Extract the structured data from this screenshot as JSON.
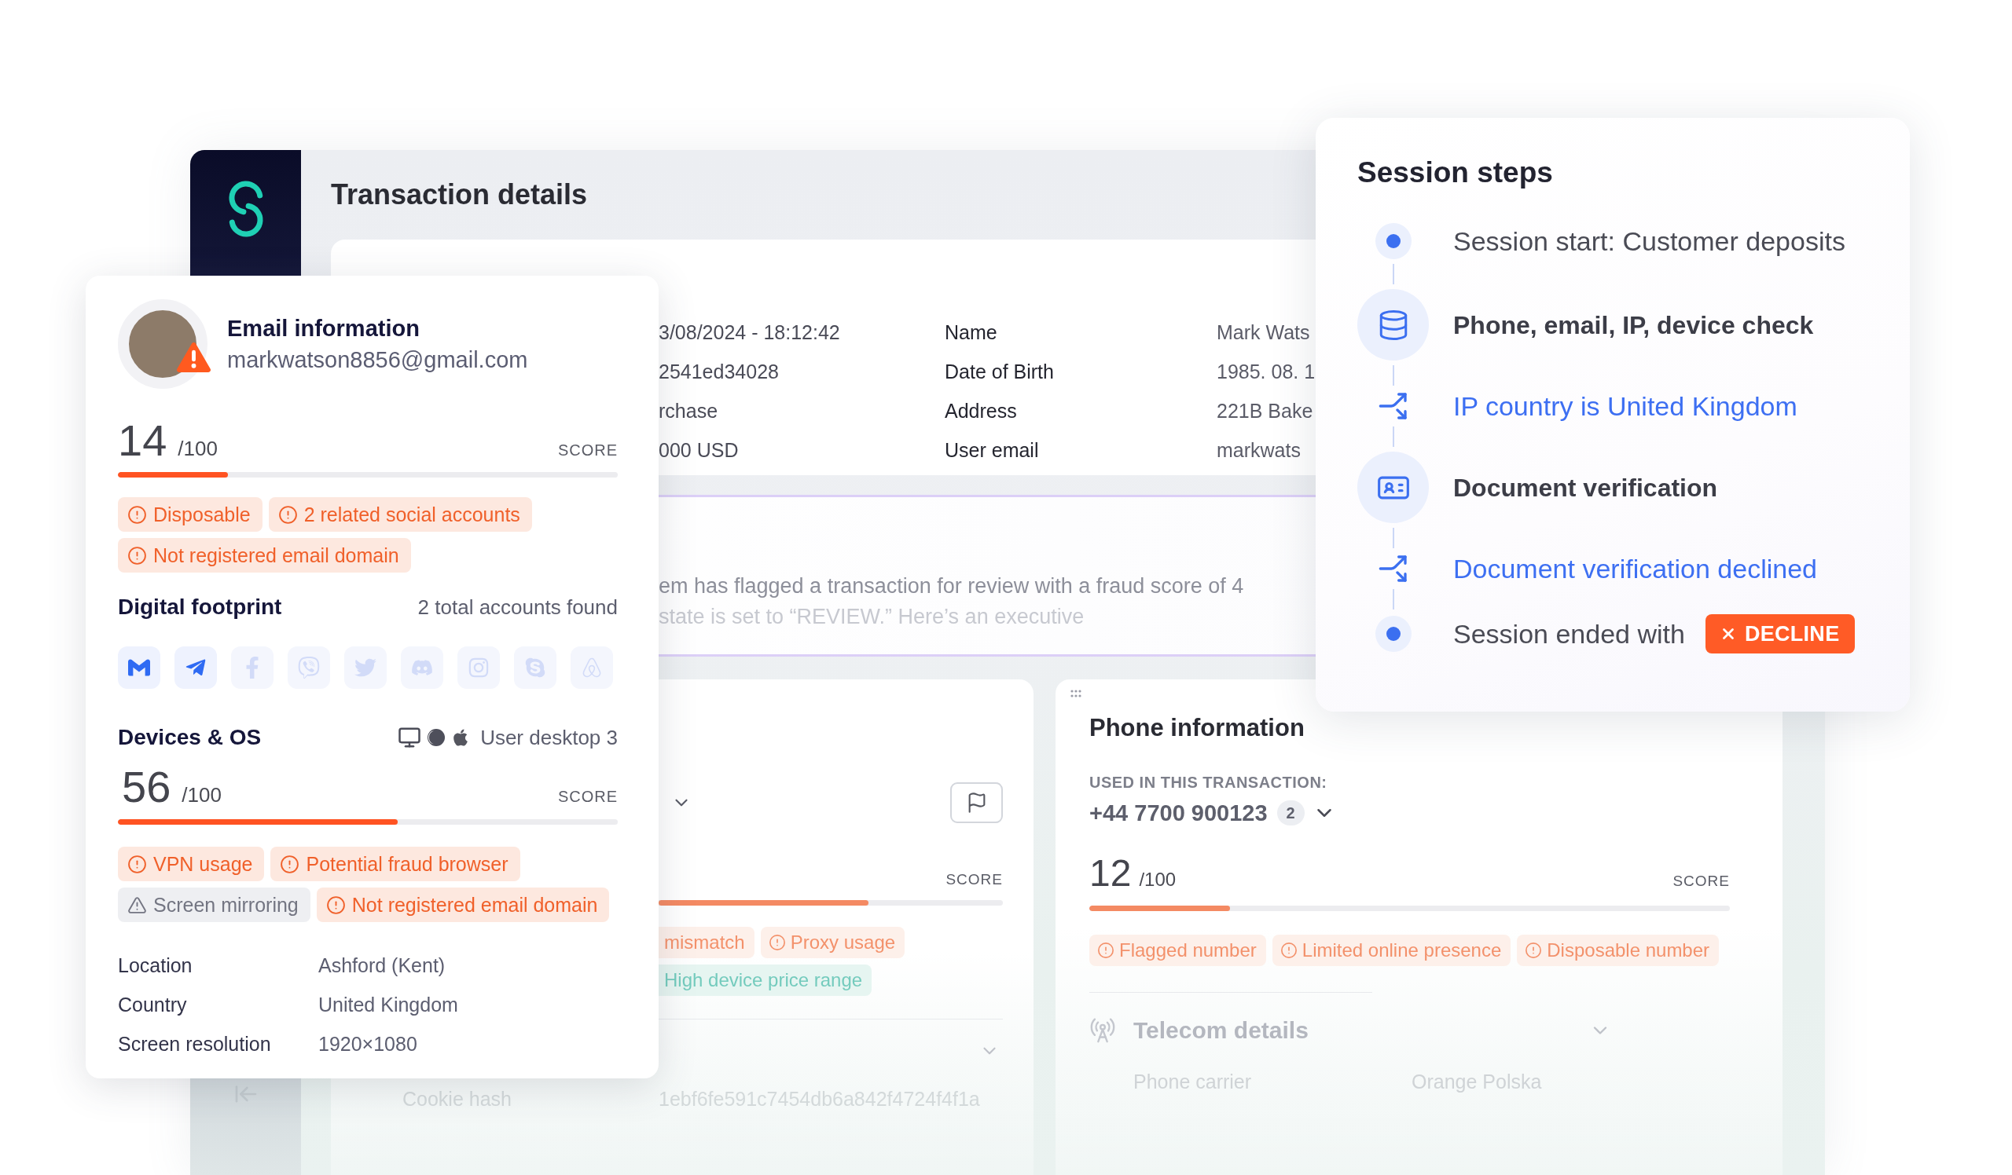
{
  "app": {
    "title": "Transaction details"
  },
  "transaction": {
    "rows": [
      {
        "value": "3/08/2024 - 18:12:42",
        "label": "Name",
        "detail": "Mark Wats"
      },
      {
        "value": "2541ed34028",
        "label": "Date of Birth",
        "detail": "1985. 08. 1"
      },
      {
        "value": "rchase",
        "label": "Address",
        "detail": "221B Bake"
      },
      {
        "value": "000 USD",
        "label": "User email",
        "detail": "markwats"
      }
    ]
  },
  "summary": {
    "lines": [
      "em has flagged a transaction for review with a fraud score of 4",
      "state is set to “REVIEW.” Here’s an executive"
    ]
  },
  "device_panel": {
    "score_label": "SCORE",
    "level": 0.61,
    "tags": [
      {
        "text": "mismatch",
        "kind": "risk",
        "clipped": true
      },
      {
        "text": "Proxy usage",
        "kind": "risk",
        "clipped": false
      },
      {
        "text": "High device price range",
        "kind": "positive",
        "clipped": true
      }
    ],
    "details": [
      {
        "label": "Cookie hash",
        "value": "1ebf6fe591c7454db6a842f4724f4f1a"
      }
    ]
  },
  "phone_panel": {
    "title": "Phone information",
    "caption": "USED IN THIS TRANSACTION:",
    "number": "+44 7700 900123",
    "count": "2",
    "score": "12",
    "score_max": "/100",
    "score_label": "SCORE",
    "level": 0.22,
    "tags": [
      {
        "text": "Flagged number",
        "kind": "risk",
        "clipped": false
      },
      {
        "text": "Limited online presence",
        "kind": "risk",
        "clipped": false
      },
      {
        "text": "Disposable number",
        "kind": "risk",
        "clipped": false
      }
    ],
    "telecom": {
      "title": "Telecom details",
      "details": [
        {
          "label": "Phone carrier",
          "value": "Orange Polska"
        }
      ]
    }
  },
  "email_card": {
    "title": "Email information",
    "email": "markwatson8856@gmail.com",
    "score": "14",
    "score_max": "/100",
    "score_label": "SCORE",
    "level": 0.22,
    "tags": [
      {
        "text": "Disposable",
        "kind": "risk",
        "clipped": false
      },
      {
        "text": "2 related social accounts",
        "kind": "risk",
        "clipped": false
      },
      {
        "text": "Not registered email domain",
        "kind": "risk",
        "clipped": false
      }
    ],
    "footprint": {
      "title": "Digital footprint",
      "summary": "2 total accounts found",
      "accounts": [
        {
          "kind": "gmail",
          "found": true
        },
        {
          "kind": "telegram",
          "found": true
        },
        {
          "kind": "facebook",
          "found": false
        },
        {
          "kind": "viber",
          "found": false
        },
        {
          "kind": "twitter",
          "found": false
        },
        {
          "kind": "discord",
          "found": false
        },
        {
          "kind": "instagram",
          "found": false
        },
        {
          "kind": "skype",
          "found": false
        },
        {
          "kind": "airbnb",
          "found": false
        }
      ]
    },
    "devices": {
      "title": "Devices & OS",
      "summary": "User desktop 3",
      "score": "56",
      "score_max": "/100",
      "score_label": "SCORE",
      "level": 0.56,
      "tags": [
        {
          "text": "VPN usage",
          "kind": "risk",
          "clipped": false
        },
        {
          "text": "Potential fraud browser",
          "kind": "risk",
          "clipped": false
        },
        {
          "text": "Screen mirroring",
          "kind": "neutral",
          "clipped": false
        },
        {
          "text": "Not registered email domain",
          "kind": "risk",
          "clipped": false
        }
      ],
      "details": [
        {
          "label": "Location",
          "value": "Ashford (Kent)"
        },
        {
          "label": "Country",
          "value": "United Kingdom"
        },
        {
          "label": "Screen resolution",
          "value": "1920×1080"
        }
      ]
    }
  },
  "session_steps": {
    "title": "Session steps",
    "steps": [
      {
        "kind": "event",
        "text": "Session start: Customer deposits"
      },
      {
        "kind": "data-check",
        "text": "Phone, email, IP, device check"
      },
      {
        "kind": "outcome",
        "text": "IP country is United Kingdom"
      },
      {
        "kind": "document-check",
        "text": "Document verification"
      },
      {
        "kind": "outcome",
        "text": "Document verification declined"
      },
      {
        "kind": "event",
        "text": "Session ended with",
        "badge": "DECLINE"
      }
    ]
  }
}
